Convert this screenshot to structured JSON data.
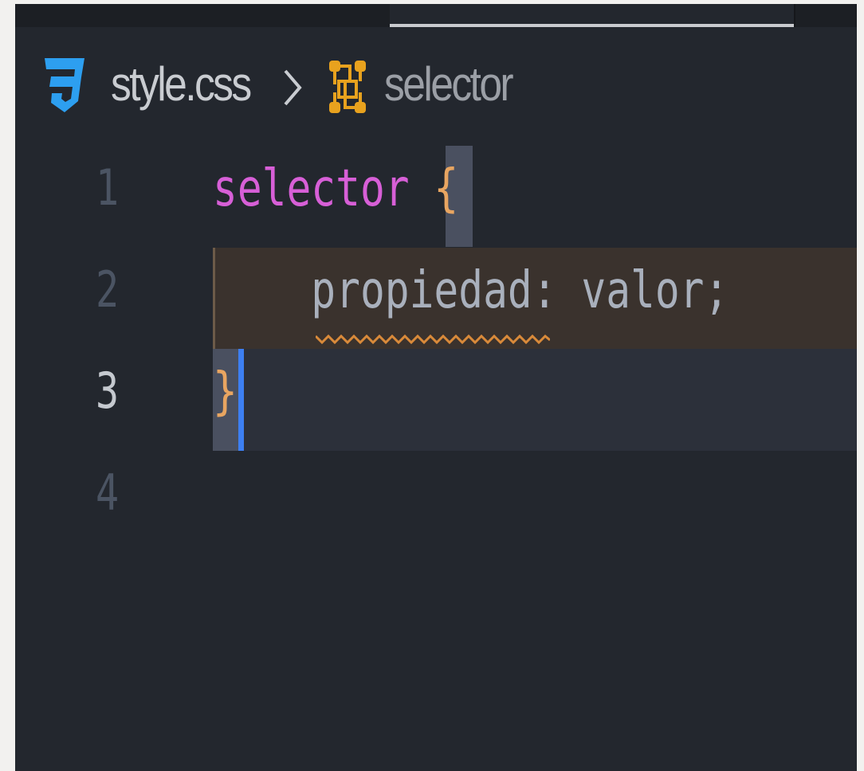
{
  "breadcrumb": {
    "file_icon": "css3-file-icon",
    "file_name": "style.css",
    "separator_icon": "chevron-right-icon",
    "symbol_icon": "css-selector-symbol-icon",
    "symbol_name": "selector"
  },
  "editor": {
    "lines": [
      {
        "number": "1",
        "selector": "selector",
        "open_brace": "{"
      },
      {
        "number": "2",
        "property": "propiedad",
        "colon": ":",
        "value": "valor",
        "semicolon": ";"
      },
      {
        "number": "3",
        "close_brace": "}"
      },
      {
        "number": "4"
      }
    ],
    "current_line": "3",
    "diagnostic": "warning-squiggle"
  },
  "colors": {
    "background": "#23272e",
    "selector": "#d75fd7",
    "brace": "#e8a561",
    "text": "#a9b0bc",
    "line_number": "#4b5463",
    "current_line_number": "#c5c9cf",
    "cursor": "#3d7ff2",
    "css_icon": "#2d9ff0",
    "symbol_icon": "#e8a21e",
    "warning": "#d98a3a"
  }
}
